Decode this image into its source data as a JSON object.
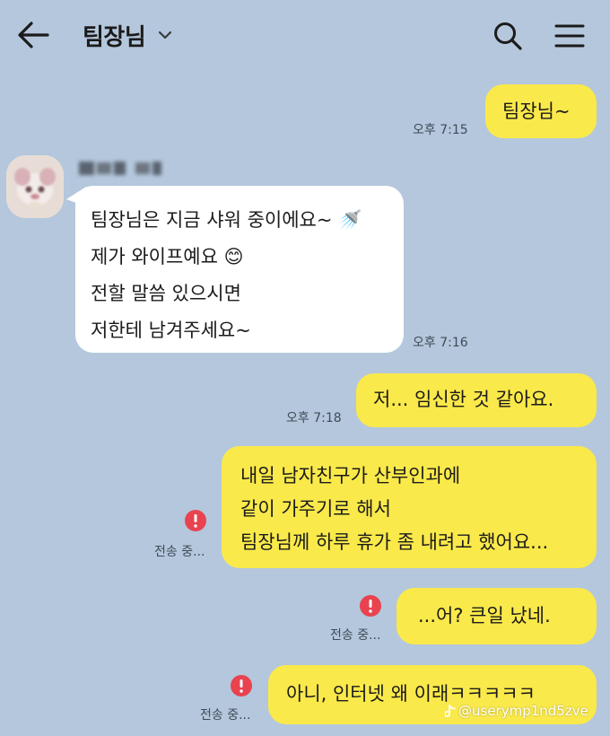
{
  "header": {
    "title": "팀장님",
    "icons": [
      "arrow-left-icon",
      "chevron-down-icon",
      "search-icon",
      "menu-icon"
    ]
  },
  "messages": [
    {
      "direction": "out",
      "lines": [
        "팀장님~"
      ],
      "time": "오후 7:15"
    },
    {
      "direction": "in",
      "lines": [
        "팀장님은 지금 샤워 중이에요~ 🚿",
        "제가 와이프예요 😊",
        "전할 말씀 있으시면",
        "저한테 남겨주세요~"
      ],
      "time": "오후 7:16"
    },
    {
      "direction": "out",
      "lines": [
        "저... 임신한 것 같아요."
      ],
      "time": "오후 7:18"
    },
    {
      "direction": "out",
      "lines": [
        "내일 남자친구가 산부인과에",
        "같이 가주기로 해서",
        "팀장님께 하루 휴가 좀 내려고 했어요..."
      ],
      "status": "전송 중..."
    },
    {
      "direction": "out",
      "lines": [
        "...어? 큰일 났네."
      ],
      "status": "전송 중..."
    },
    {
      "direction": "out",
      "lines": [
        "아니, 인터넷 왜 이래ㅋㅋㅋㅋㅋ"
      ],
      "status": "전송 중..."
    }
  ],
  "watermark": "@userymp1nd5zve",
  "colors": {
    "background": "#b4c7dc",
    "outgoing_bubble": "#fae94a",
    "incoming_bubble": "#ffffff",
    "error": "#e8434f"
  }
}
